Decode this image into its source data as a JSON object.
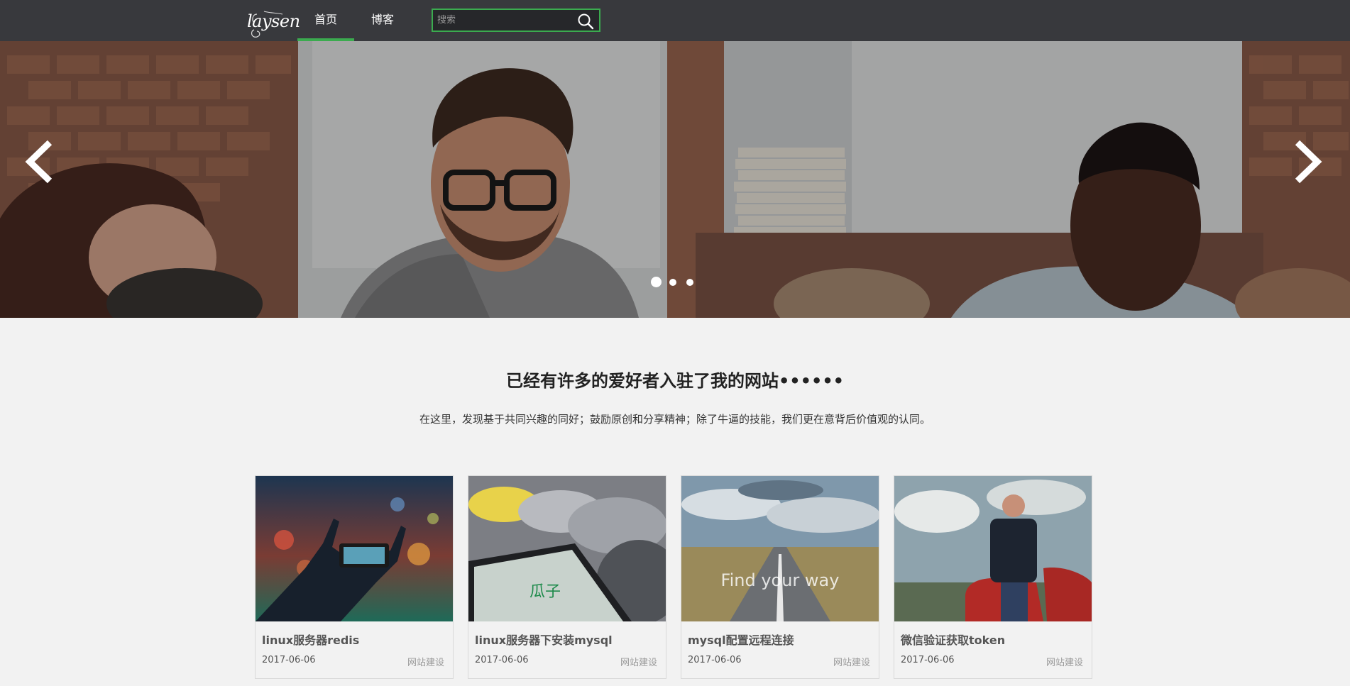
{
  "header": {
    "logo_text": "laysen",
    "tabs": [
      {
        "label": "首页",
        "active": true
      },
      {
        "label": "博客",
        "active": false
      }
    ],
    "search": {
      "placeholder": "搜索",
      "value": ""
    }
  },
  "banner": {
    "slide_count": 3,
    "active_slide": 1,
    "prev_icon": "chevron-left-icon",
    "next_icon": "chevron-right-icon"
  },
  "intro": {
    "headline": "已经有许多的爱好者入驻了我的网站••••••",
    "description": "在这里，发现基于共同兴趣的同好；鼓励原创和分享精神；除了牛逼的技能，我们更在意背后价值观的认同。"
  },
  "posts": [
    {
      "title": "linux服务器redis",
      "date": "2017-06-06",
      "category": "网站建设"
    },
    {
      "title": "linux服务器下安装mysql",
      "date": "2017-06-06",
      "category": "网站建设",
      "image_text": "瓜子"
    },
    {
      "title": "mysql配置远程连接",
      "date": "2017-06-06",
      "category": "网站建设",
      "image_text": "Find your way"
    },
    {
      "title": "微信验证获取token",
      "date": "2017-06-06",
      "category": "网站建设"
    }
  ],
  "colors": {
    "nav_bg": "#38393d",
    "accent": "#3bab4f",
    "page_bg": "#f2f2f2"
  }
}
